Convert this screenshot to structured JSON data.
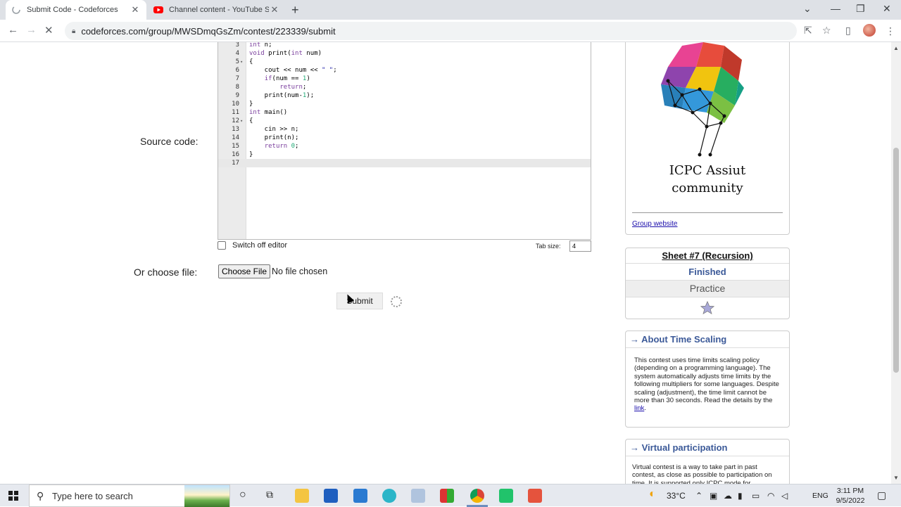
{
  "browser": {
    "tabs": [
      {
        "title": "Submit Code - Codeforces",
        "active": true
      },
      {
        "title": "Channel content - YouTube Studi",
        "active": false
      }
    ],
    "new_tab": "+",
    "url": "codeforces.com/group/MWSDmqGsZm/contest/223339/submit",
    "controls": {
      "minimize": "—",
      "maximize": "❐",
      "close": "✕"
    }
  },
  "form": {
    "source_label": "Source code:",
    "file_label": "Or choose file:",
    "switch_off_editor": "Switch off editor",
    "tab_size_label": "Tab size:",
    "tab_size_value": "4",
    "choose_file_button": "Choose File",
    "no_file": "No file chosen",
    "submit_button": "Submit"
  },
  "code_lines": [
    {
      "n": "3",
      "fold": "",
      "code": "int n;"
    },
    {
      "n": "4",
      "fold": "",
      "code": "void print(int num)"
    },
    {
      "n": "5",
      "fold": "▾",
      "code": "{"
    },
    {
      "n": "6",
      "fold": "",
      "code": "    cout << num << \" \";"
    },
    {
      "n": "7",
      "fold": "",
      "code": "    if(num == 1)"
    },
    {
      "n": "8",
      "fold": "",
      "code": "        return;"
    },
    {
      "n": "9",
      "fold": "",
      "code": "    print(num-1);"
    },
    {
      "n": "10",
      "fold": "",
      "code": "}"
    },
    {
      "n": "11",
      "fold": "",
      "code": "int main()"
    },
    {
      "n": "12",
      "fold": "▾",
      "code": "{"
    },
    {
      "n": "13",
      "fold": "",
      "code": "    cin >> n;"
    },
    {
      "n": "14",
      "fold": "",
      "code": "    print(n);"
    },
    {
      "n": "15",
      "fold": "",
      "code": "    return 0;"
    },
    {
      "n": "16",
      "fold": "",
      "code": "}"
    },
    {
      "n": "17",
      "fold": "",
      "code": ""
    }
  ],
  "sidebar": {
    "logo_line1": "ICPC Assiut",
    "logo_line2": "community",
    "group_website": "Group website",
    "sheet_title": "Sheet #7 (Recursion)",
    "sheet_status": "Finished",
    "sheet_mode": "Practice",
    "time_scaling": {
      "title": "About Time Scaling",
      "text": "This contest uses time limits scaling policy (depending on a programming language). The system automatically adjusts time limits by the following multipliers for some languages. Despite scaling (adjustment), the time limit cannot be more than 30 seconds. Read the details by the ",
      "link": "link",
      "after": "."
    },
    "virtual": {
      "title": "Virtual participation",
      "text": "Virtual contest is a way to take part in past contest, as close as possible to participation on time. It is supported only ICPC mode for"
    },
    "arrow": "→"
  },
  "taskbar": {
    "search_placeholder": "Type here to search",
    "weather": "33°C",
    "lang": "ENG",
    "time": "3:11 PM",
    "date": "9/5/2022"
  },
  "colors": {
    "link": "#1a0dab",
    "box_title": "#3b5998"
  }
}
